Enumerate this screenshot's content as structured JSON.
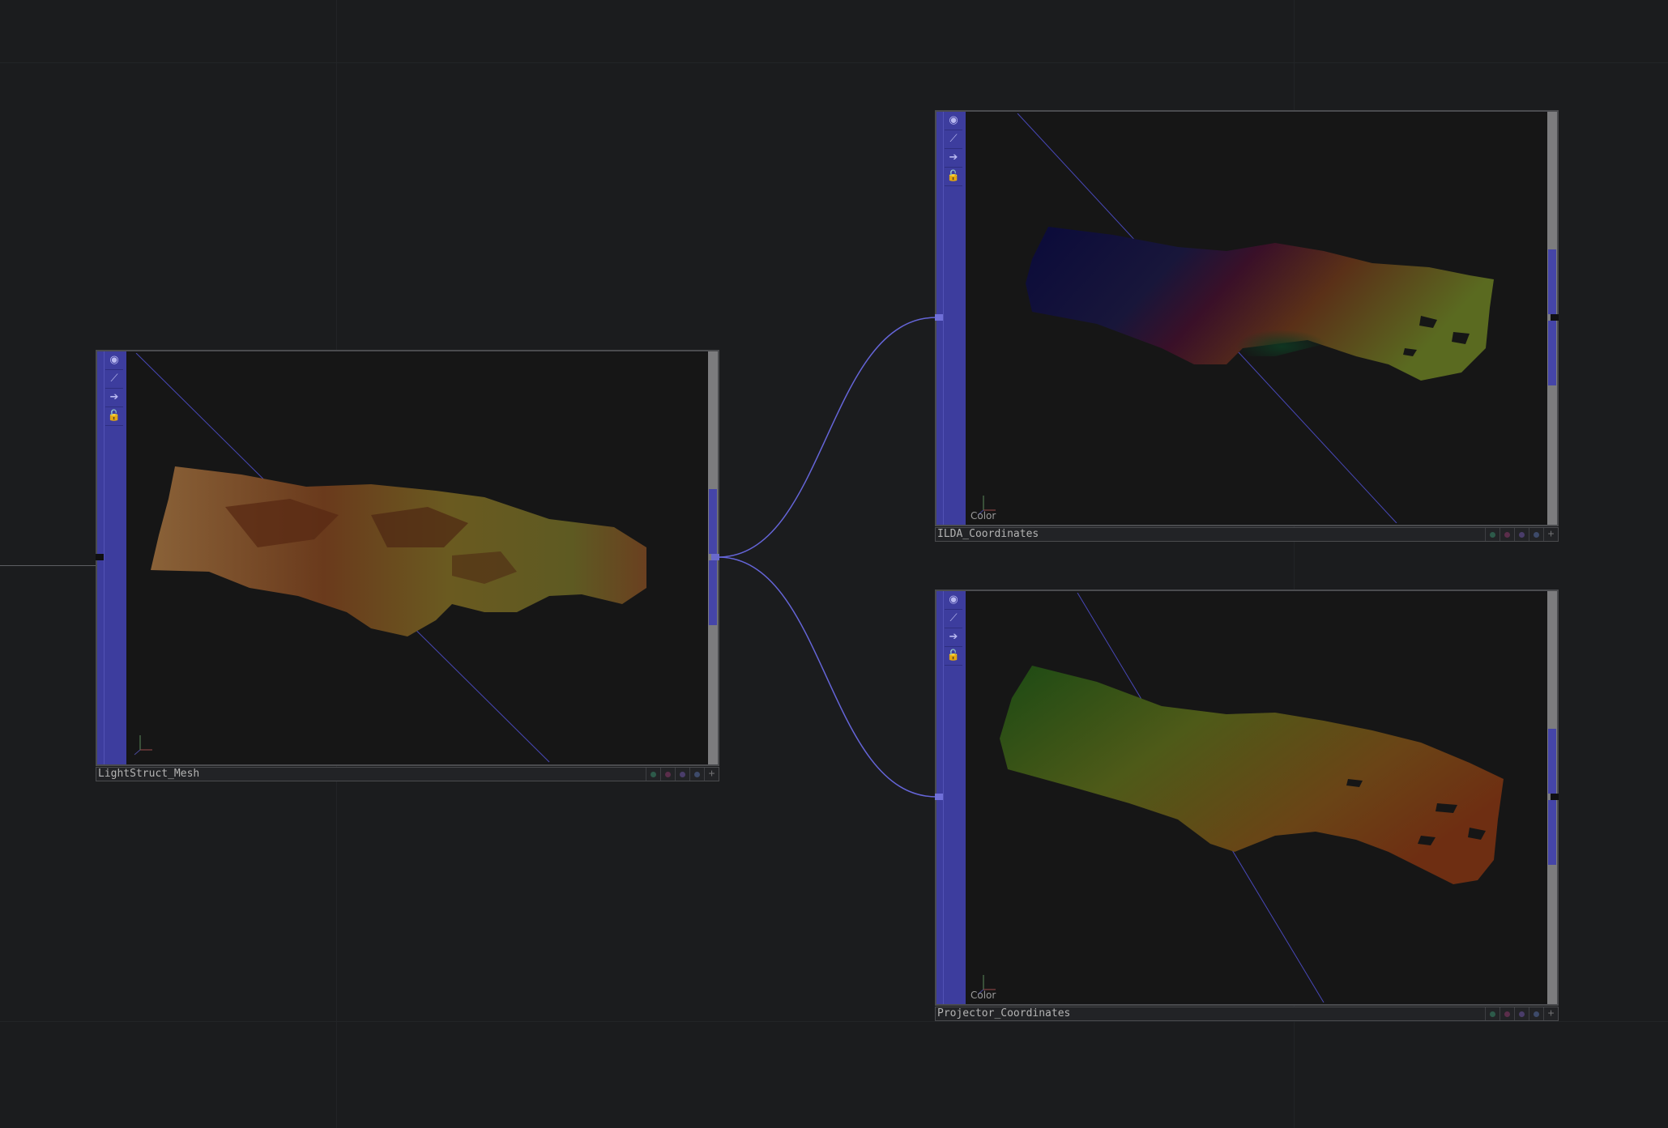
{
  "network": {
    "nodes": [
      {
        "id": "lightstruct",
        "name": "LightStruct_Mesh",
        "viewer_label": ""
      },
      {
        "id": "ilda",
        "name": "ILDA_Coordinates",
        "viewer_label": "Color"
      },
      {
        "id": "projector",
        "name": "Projector_Coordinates",
        "viewer_label": "Color"
      }
    ],
    "flag_icons": [
      "viewer-active-icon",
      "bypass-icon",
      "display-icon",
      "lock-icon"
    ],
    "flag_glyphs": [
      "◉",
      "⟋",
      "➔",
      "🔓"
    ],
    "name_bar_plus": "+",
    "status_dot_colors": [
      "#2d5a4a",
      "#5a2d4a",
      "#4a3d6a",
      "#3d4a6a"
    ],
    "accent_color": "#3d3d9e",
    "wire_color": "#6565d8",
    "background_color": "#1b1c1e"
  }
}
